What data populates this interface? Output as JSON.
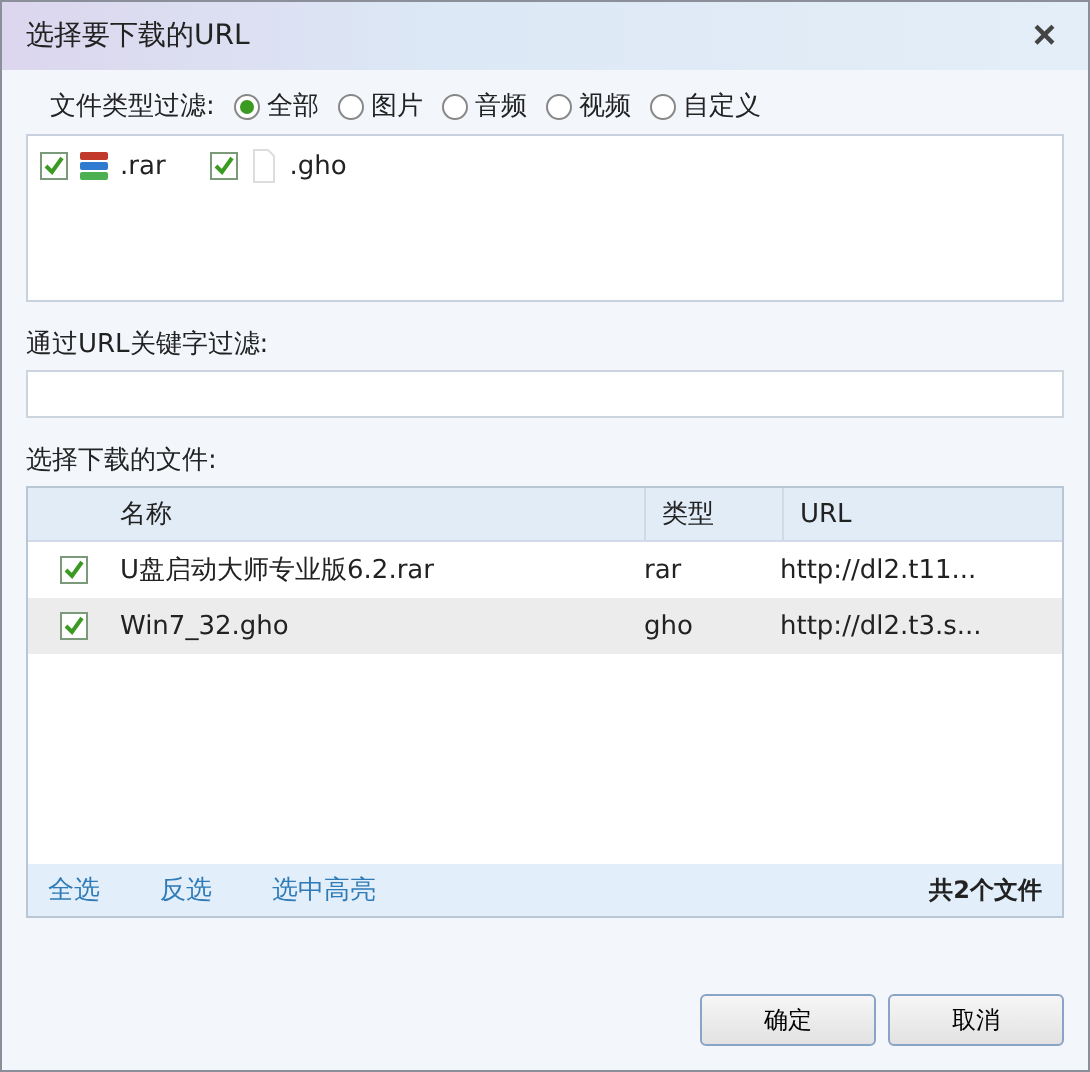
{
  "window": {
    "title": "选择要下载的URL",
    "close": "×"
  },
  "type_filter": {
    "label": "文件类型过滤:",
    "options": [
      {
        "label": "全部",
        "selected": true
      },
      {
        "label": "图片",
        "selected": false
      },
      {
        "label": "音频",
        "selected": false
      },
      {
        "label": "视频",
        "selected": false
      },
      {
        "label": "自定义",
        "selected": false
      }
    ]
  },
  "file_types": [
    {
      "label": ".rar",
      "checked": true,
      "kind": "archive"
    },
    {
      "label": ".gho",
      "checked": true,
      "kind": "blank"
    }
  ],
  "keyword_filter": {
    "label": "通过URL关键字过滤:"
  },
  "files": {
    "label": "选择下载的文件:",
    "columns": [
      "名称",
      "类型",
      "URL"
    ],
    "rows": [
      {
        "name": "U盘启动大师专业版6.2.rar",
        "type": "rar",
        "url": "http://dl2.t11...",
        "checked": true
      },
      {
        "name": "Win7_32.gho",
        "type": "gho",
        "url": "http://dl2.t3.s...",
        "checked": true
      }
    ],
    "links": [
      "全选",
      "反选",
      "选中高亮"
    ],
    "count": "共2个文件"
  },
  "buttons": [
    "确定",
    "取消"
  ]
}
